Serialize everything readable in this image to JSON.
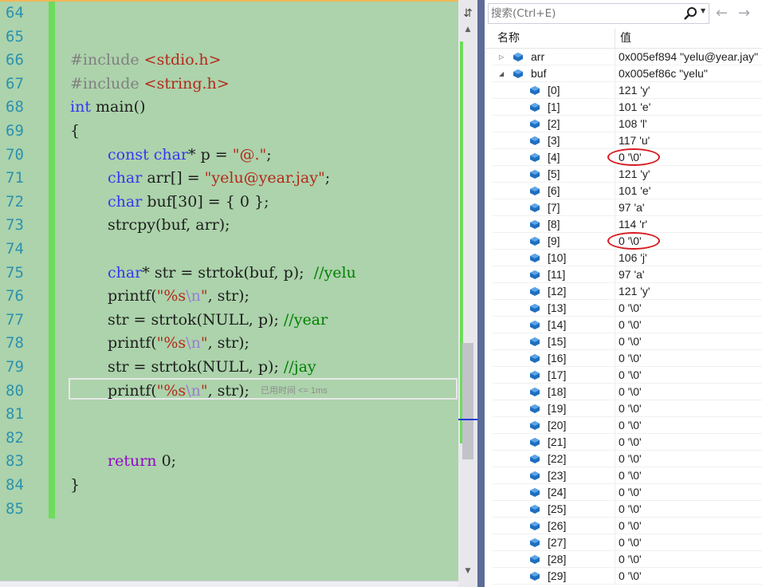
{
  "editor": {
    "lines": [
      {
        "num": "64"
      },
      {
        "num": "65"
      },
      {
        "num": "66",
        "include_kw": "#include",
        "include_file": "<stdio.h>"
      },
      {
        "num": "67",
        "include_kw": "#include",
        "include_file": "<string.h>"
      },
      {
        "num": "68",
        "t1": "int",
        "t2": " main()"
      },
      {
        "num": "69",
        "t1": "{"
      },
      {
        "num": "70",
        "t1": "const",
        "t2": " ",
        "t3": "char",
        "t4": "* p = ",
        "t5": "\"@.\"",
        "t6": ";"
      },
      {
        "num": "71",
        "t1": "char",
        "t2": " arr[] = ",
        "t3": "\"yelu@year.jay\"",
        "t4": ";"
      },
      {
        "num": "72",
        "t1": "char",
        "t2": " buf[30] = { 0 };"
      },
      {
        "num": "73",
        "t1": "strcpy(buf, arr);"
      },
      {
        "num": "74"
      },
      {
        "num": "75",
        "t1": "char",
        "t2": "* str = strtok(buf, p);  ",
        "t3": "//yelu"
      },
      {
        "num": "76",
        "t1": "printf(",
        "t2": "\"%s",
        "t3": "\\n",
        "t4": "\"",
        "t5": ", str);"
      },
      {
        "num": "77",
        "t1": "str = strtok(NULL, p); ",
        "t2": "//year"
      },
      {
        "num": "78",
        "t1": "printf(",
        "t2": "\"%s",
        "t3": "\\n",
        "t4": "\"",
        "t5": ", str);"
      },
      {
        "num": "79",
        "t1": "str = strtok(NULL, p); ",
        "t2": "//jay"
      },
      {
        "num": "80",
        "t1": "printf(",
        "t2": "\"%s",
        "t3": "\\n",
        "t4": "\"",
        "t5": ", str);",
        "hint": "已用时间 <= 1ms"
      },
      {
        "num": "81"
      },
      {
        "num": "82"
      },
      {
        "num": "83",
        "t1": "return",
        "t2": " 0;"
      },
      {
        "num": "84",
        "t1": "}"
      },
      {
        "num": "85"
      }
    ]
  },
  "watch": {
    "search_placeholder": "搜索(Ctrl+E)",
    "col_name": "名称",
    "col_value": "值",
    "rows": [
      {
        "name": "arr",
        "value": "0x005ef894 \"yelu@year.jay\"",
        "expander": "▷",
        "expanded": false
      },
      {
        "name": "buf",
        "value": "0x005ef86c \"yelu\"",
        "expander": "◢",
        "expanded": true
      },
      {
        "name": "[0]",
        "value": "121 'y'"
      },
      {
        "name": "[1]",
        "value": "101 'e'"
      },
      {
        "name": "[2]",
        "value": "108 'l'"
      },
      {
        "name": "[3]",
        "value": "117 'u'"
      },
      {
        "name": "[4]",
        "value": "0 '\\0'",
        "circled": true
      },
      {
        "name": "[5]",
        "value": "121 'y'"
      },
      {
        "name": "[6]",
        "value": "101 'e'"
      },
      {
        "name": "[7]",
        "value": "97 'a'"
      },
      {
        "name": "[8]",
        "value": "114 'r'"
      },
      {
        "name": "[9]",
        "value": "0 '\\0'",
        "circled": true
      },
      {
        "name": "[10]",
        "value": "106 'j'"
      },
      {
        "name": "[11]",
        "value": "97 'a'"
      },
      {
        "name": "[12]",
        "value": "121 'y'"
      },
      {
        "name": "[13]",
        "value": "0 '\\0'"
      },
      {
        "name": "[14]",
        "value": "0 '\\0'"
      },
      {
        "name": "[15]",
        "value": "0 '\\0'"
      },
      {
        "name": "[16]",
        "value": "0 '\\0'"
      },
      {
        "name": "[17]",
        "value": "0 '\\0'"
      },
      {
        "name": "[18]",
        "value": "0 '\\0'"
      },
      {
        "name": "[19]",
        "value": "0 '\\0'"
      },
      {
        "name": "[20]",
        "value": "0 '\\0'"
      },
      {
        "name": "[21]",
        "value": "0 '\\0'"
      },
      {
        "name": "[22]",
        "value": "0 '\\0'"
      },
      {
        "name": "[23]",
        "value": "0 '\\0'"
      },
      {
        "name": "[24]",
        "value": "0 '\\0'"
      },
      {
        "name": "[25]",
        "value": "0 '\\0'"
      },
      {
        "name": "[26]",
        "value": "0 '\\0'"
      },
      {
        "name": "[27]",
        "value": "0 '\\0'"
      },
      {
        "name": "[28]",
        "value": "0 '\\0'"
      },
      {
        "name": "[29]",
        "value": "0 '\\0'"
      }
    ]
  },
  "colors": {
    "editor_bg": "#acd3ab",
    "keyword": "#3636f2",
    "string": "#b5281c",
    "comment": "#008000",
    "line_number": "#2b91af",
    "annotation_circle": "#d8191f"
  },
  "icons": {
    "split": "split-editor-icon",
    "search": "search-icon",
    "back": "arrow-left-icon",
    "forward": "arrow-right-icon",
    "variable": "variable-cube-icon"
  }
}
